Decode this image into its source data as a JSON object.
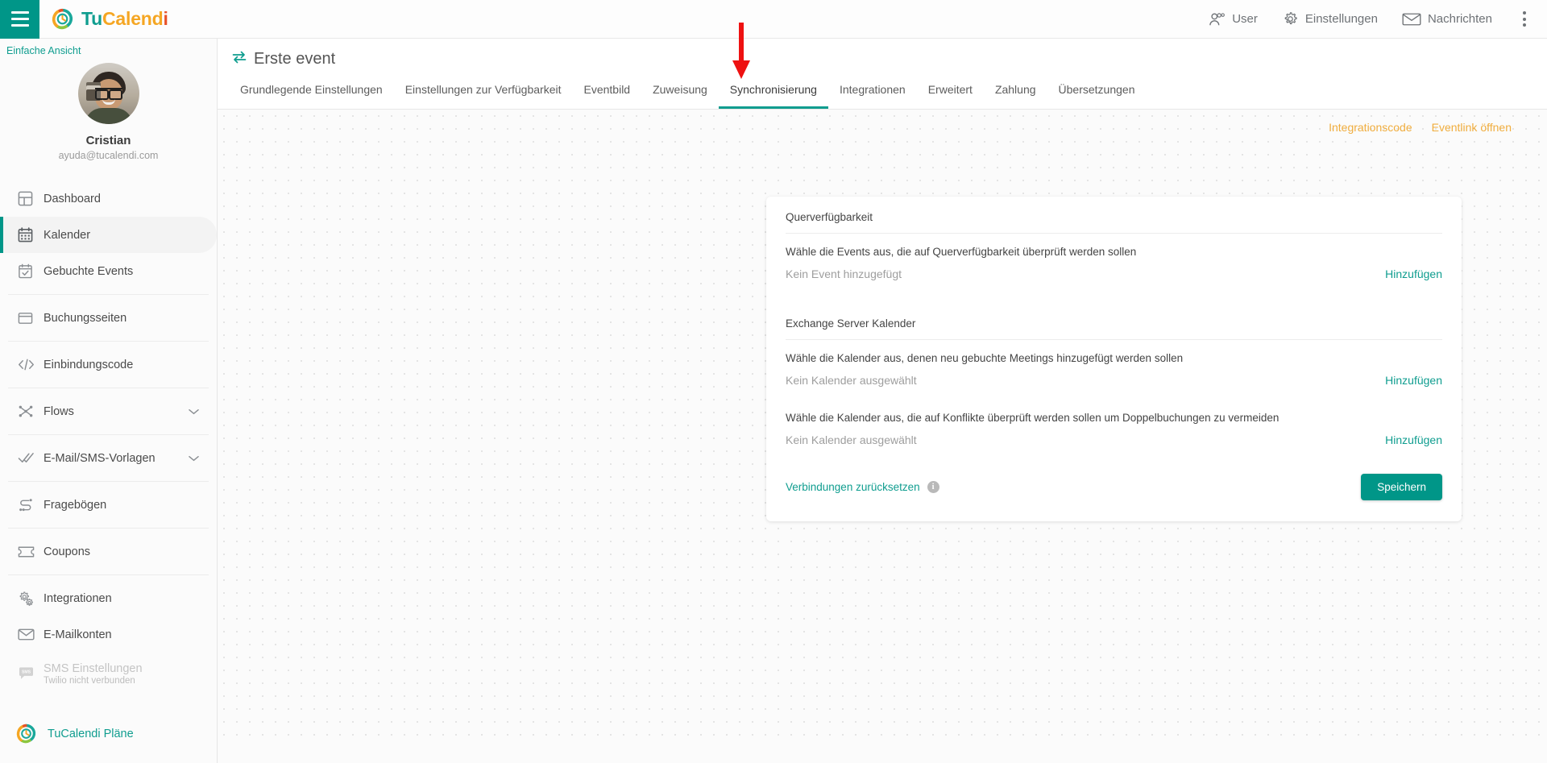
{
  "topbar": {
    "logo_text": {
      "tu": "Tu",
      "cal": "Cal",
      "end": "end",
      "i": "i"
    },
    "menu_icon": "hamburger-icon",
    "items": [
      {
        "label": "User",
        "icon": "users-icon"
      },
      {
        "label": "Einstellungen",
        "icon": "gear-icon"
      },
      {
        "label": "Nachrichten",
        "icon": "envelope-icon"
      }
    ],
    "overflow_icon": "kebab-menu-icon"
  },
  "sidebar": {
    "simple_view": "Einfache Ansicht",
    "profile": {
      "name": "Cristian",
      "email": "ayuda@tucalendi.com",
      "avatar": "user-avatar"
    },
    "items": [
      {
        "label": "Dashboard",
        "icon": "dashboard-icon",
        "active": false,
        "divider_after": false
      },
      {
        "label": "Kalender",
        "icon": "calendar-icon",
        "active": true,
        "divider_after": false
      },
      {
        "label": "Gebuchte Events",
        "icon": "calendar-check-icon",
        "active": false,
        "divider_after": true
      },
      {
        "label": "Buchungsseiten",
        "icon": "booking-page-icon",
        "active": false,
        "divider_after": true
      },
      {
        "label": "Einbindungscode",
        "icon": "code-icon",
        "active": false,
        "divider_after": true
      },
      {
        "label": "Flows",
        "icon": "flows-icon",
        "active": false,
        "divider_after": true,
        "chevron": "chevron-down-icon"
      },
      {
        "label": "E-Mail/SMS-Vorlagen",
        "icon": "double-check-icon",
        "active": false,
        "divider_after": true,
        "chevron": "chevron-down-icon"
      },
      {
        "label": "Fragebögen",
        "icon": "survey-icon",
        "active": false,
        "divider_after": true
      },
      {
        "label": "Coupons",
        "icon": "coupon-icon",
        "active": false,
        "divider_after": true
      },
      {
        "label": "Integrationen",
        "icon": "integrations-icon",
        "active": false,
        "divider_after": false
      },
      {
        "label": "E-Mailkonten",
        "icon": "mail-accounts-icon",
        "active": false,
        "divider_after": false
      },
      {
        "label": "SMS Einstellungen",
        "sublabel": "Twilio nicht verbunden",
        "icon": "sms-icon",
        "active": false,
        "disabled": true,
        "divider_after": false
      }
    ],
    "plans": {
      "label": "TuCalendi Pläne",
      "icon": "tucalendi-logo-icon"
    }
  },
  "main": {
    "page_title": "Erste event",
    "page_title_icon": "sync-arrows-icon",
    "tabs": [
      {
        "label": "Grundlegende Einstellungen",
        "active": false
      },
      {
        "label": "Einstellungen zur Verfügbarkeit",
        "active": false
      },
      {
        "label": "Eventbild",
        "active": false
      },
      {
        "label": "Zuweisung",
        "active": false
      },
      {
        "label": "Synchronisierung",
        "active": true
      },
      {
        "label": "Integrationen",
        "active": false
      },
      {
        "label": "Erweitert",
        "active": false
      },
      {
        "label": "Zahlung",
        "active": false
      },
      {
        "label": "Übersetzungen",
        "active": false
      }
    ],
    "quicklinks": [
      {
        "label": "Integrationscode"
      },
      {
        "label": "Eventlink öffnen"
      }
    ],
    "card": {
      "sections": [
        {
          "title": "Quer­verfügbarkeit",
          "title_text": "Querverfügbarkeit",
          "blocks": [
            {
              "description": "Wähle die Events aus, die auf Querverfügbarkeit überprüft werden sollen",
              "value": "Kein Event hinzugefügt",
              "action": "Hinzufügen"
            }
          ]
        },
        {
          "title_text": "Exchange Server Kalender",
          "blocks": [
            {
              "description": "Wähle die Kalender aus, denen neu gebuchte Meetings hinzugefügt werden sollen",
              "value": "Kein Kalender ausgewählt",
              "action": "Hinzufügen"
            },
            {
              "description": "Wähle die Kalender aus, die auf Konflikte überprüft werden sollen um Doppelbuchungen zu vermeiden",
              "value": "Kein Kalender ausgewählt",
              "action": "Hinzufügen"
            }
          ]
        }
      ],
      "footer": {
        "reset_label": "Verbindungen zurücksetzen",
        "info_icon": "info-icon",
        "save_label": "Speichern"
      }
    },
    "annotation": {
      "arrow": "red-down-arrow",
      "points_at": "Synchronisierung"
    }
  },
  "colors": {
    "teal": "#009688",
    "teal_link": "#0f9d8f",
    "orange": "#f0ad3e",
    "red_arrow": "#ee1111"
  }
}
